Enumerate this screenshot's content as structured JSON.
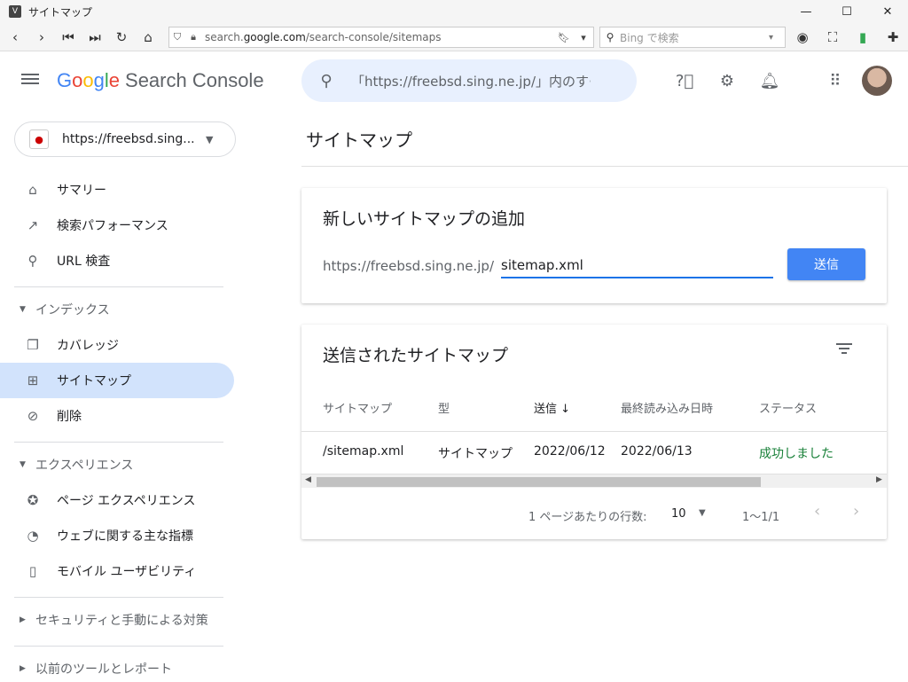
{
  "window": {
    "title": "サイトマップ",
    "minimize": "—",
    "maximize": "☐",
    "close": "✕"
  },
  "browser": {
    "url_prefix": "search.",
    "url_domain": "google.com",
    "url_path": "/search-console/sitemaps",
    "search_placeholder": "Bing で検索"
  },
  "header": {
    "logo_g": "G",
    "logo_o1": "o",
    "logo_o2": "o",
    "logo_g2": "g",
    "logo_l": "l",
    "logo_e": "e",
    "product": "Search Console",
    "search_text": "「https://freebsd.sing.ne.jp/」内のす·"
  },
  "sidebar": {
    "property": "https://freebsd.sing....",
    "items": {
      "summary": "サマリー",
      "performance": "検索パフォーマンス",
      "url_inspection": "URL 検査",
      "index_section": "インデックス",
      "coverage": "カバレッジ",
      "sitemaps": "サイトマップ",
      "removals": "削除",
      "experience_section": "エクスペリエンス",
      "page_experience": "ページ エクスペリエンス",
      "core_web_vitals": "ウェブに関する主な指標",
      "mobile_usability": "モバイル ユーザビリティ",
      "security_section": "セキュリティと手動による対策",
      "legacy_section": "以前のツールとレポート"
    }
  },
  "main": {
    "page_title": "サイトマップ",
    "add_card": {
      "title": "新しいサイトマップの追加",
      "url_prefix": "https://freebsd.sing.ne.jp/",
      "input_value": "sitemap.xml",
      "submit_label": "送信"
    },
    "submitted_card": {
      "title": "送信されたサイトマップ",
      "columns": {
        "sitemap": "サイトマップ",
        "type": "型",
        "submitted": "送信",
        "last_read": "最終読み込み日時",
        "status": "ステータス"
      },
      "sort_arrow": "↓",
      "rows": [
        {
          "sitemap": "/sitemap.xml",
          "type": "サイトマップ",
          "submitted": "2022/06/12",
          "last_read": "2022/06/13",
          "status": "成功しました"
        }
      ],
      "pager": {
        "rows_label": "1 ページあたりの行数:",
        "rows_value": "10",
        "range": "1〜1/1"
      }
    }
  },
  "colors": {
    "accent": "#4285f4",
    "success": "#188038",
    "active_nav": "#d2e3fc",
    "search_bg": "#e8f0fe"
  }
}
